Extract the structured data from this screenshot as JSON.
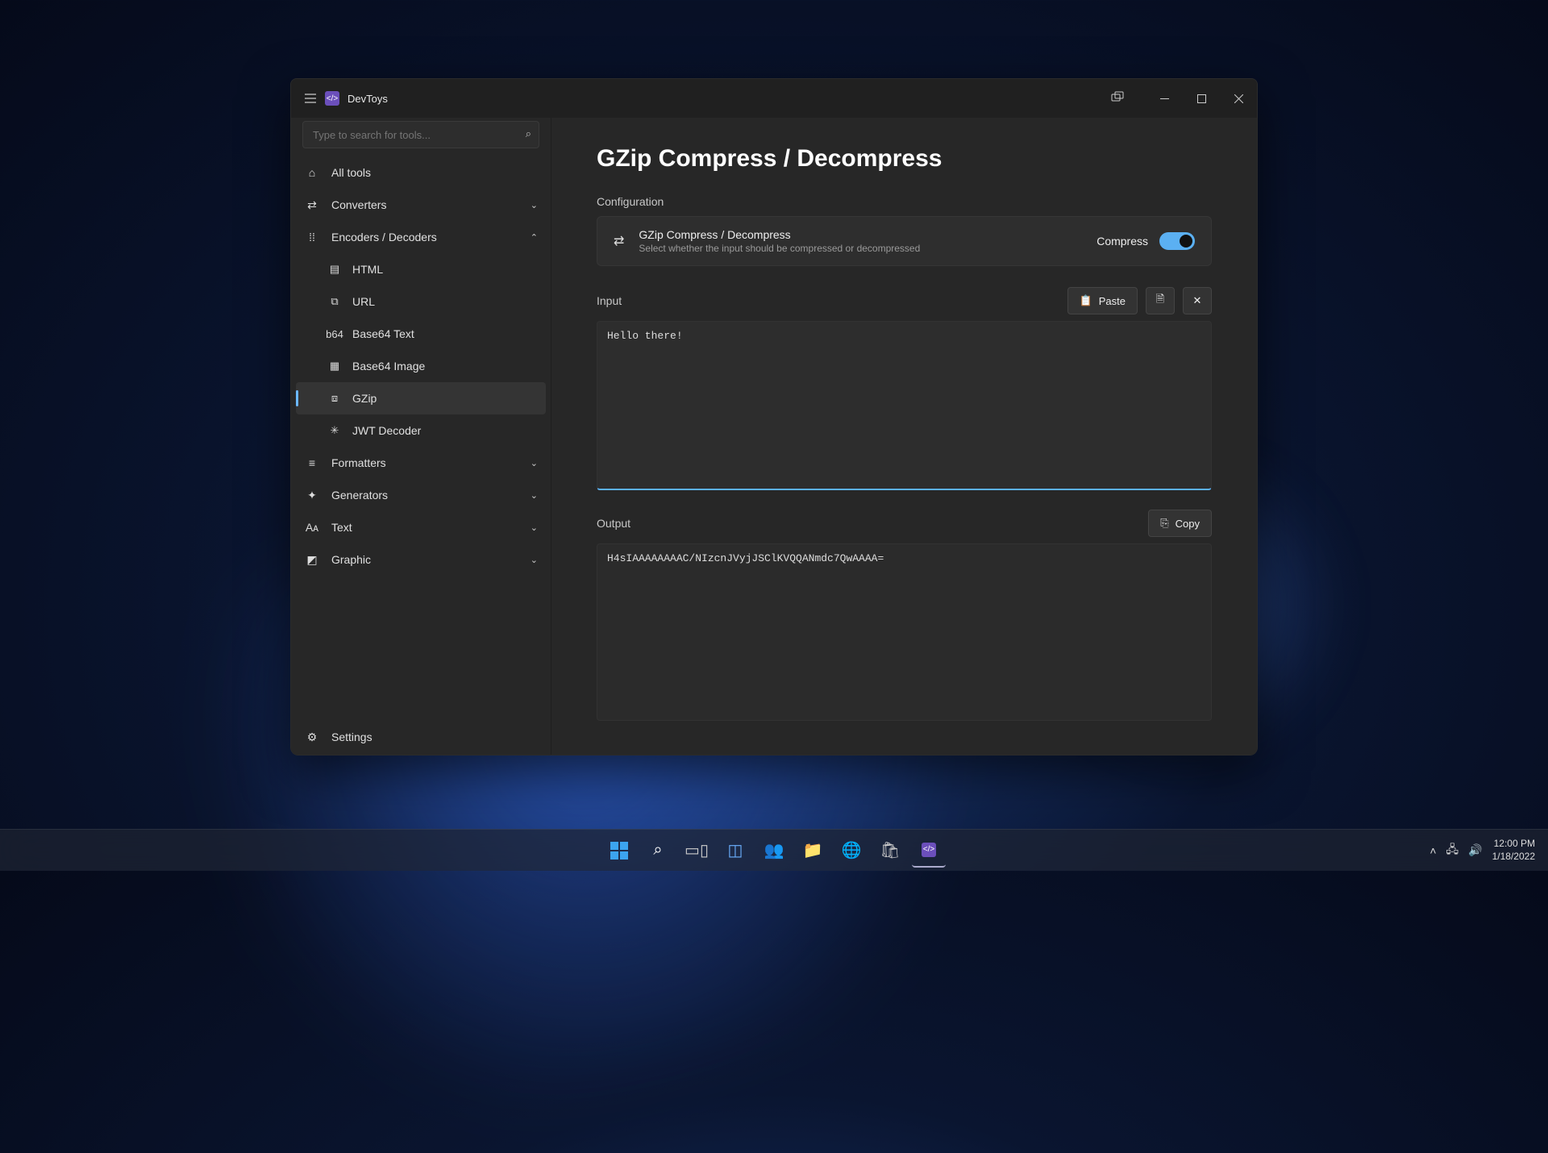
{
  "app": {
    "title": "DevToys"
  },
  "search": {
    "placeholder": "Type to search for tools..."
  },
  "sidebar": {
    "all_tools": "All tools",
    "groups": {
      "converters": "Converters",
      "encoders": "Encoders / Decoders",
      "formatters": "Formatters",
      "generators": "Generators",
      "text": "Text",
      "graphic": "Graphic"
    },
    "encoders_children": [
      {
        "label": "HTML"
      },
      {
        "label": "URL"
      },
      {
        "label": "Base64 Text"
      },
      {
        "label": "Base64 Image"
      },
      {
        "label": "GZip"
      },
      {
        "label": "JWT Decoder"
      }
    ],
    "settings": "Settings"
  },
  "page": {
    "title": "GZip Compress / Decompress",
    "config_label": "Configuration",
    "config": {
      "title": "GZip Compress / Decompress",
      "subtitle": "Select whether the input should be compressed or decompressed",
      "mode": "Compress"
    },
    "input_label": "Input",
    "paste_label": "Paste",
    "input_value": "Hello there!",
    "output_label": "Output",
    "copy_label": "Copy",
    "output_value": "H4sIAAAAAAAAC/NIzcnJVyjJSClKVQQANmdc7QwAAAA="
  },
  "taskbar": {
    "time": "12:00 PM",
    "date": "1/18/2022"
  }
}
